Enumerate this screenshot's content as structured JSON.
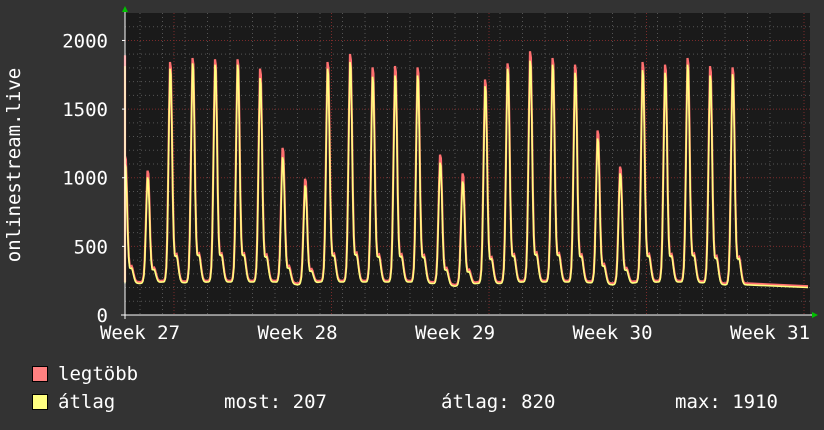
{
  "chart_data": {
    "type": "line",
    "ylabel": "onlinestream.live",
    "y_ticks": [
      0,
      500,
      1000,
      1500,
      2000
    ],
    "ylim": [
      0,
      2200
    ],
    "x_ticks": [
      "Week 27",
      "Week 28",
      "Week 29",
      "Week 30",
      "Week 31"
    ],
    "grid": true,
    "daily_peaks_max": [
      1930,
      1900,
      1180,
      1070,
      1880,
      1910,
      1900,
      1900,
      1830,
      1240,
      1010,
      1880,
      1940,
      1840,
      1850,
      1840,
      1190,
      1050,
      1750,
      1870,
      1960,
      1910,
      1860,
      1370,
      1100,
      1880,
      1860,
      1910,
      1850,
      1840
    ],
    "daily_peaks_avg": [
      1850,
      1830,
      1120,
      1020,
      1830,
      1870,
      1860,
      1860,
      1760,
      1170,
      960,
      1830,
      1880,
      1770,
      1780,
      1780,
      1130,
      990,
      1700,
      1830,
      1890,
      1860,
      1800,
      1310,
      1050,
      1820,
      1800,
      1860,
      1780,
      1790
    ],
    "daily_troughs": [
      240,
      240,
      250,
      240,
      250,
      245,
      250,
      250,
      250,
      250,
      230,
      250,
      250,
      250,
      250,
      250,
      240,
      220,
      240,
      240,
      250,
      250,
      250,
      245,
      230,
      245,
      250,
      250,
      245,
      230
    ],
    "series": [
      {
        "name": "legtöbb",
        "color": "#ff7070"
      },
      {
        "name": "átlag",
        "color": "#ffff80"
      }
    ]
  },
  "legend": {
    "max_label": "legtöbb",
    "avg_label": "átlag",
    "max_color": "#ff8080",
    "avg_color": "#ffff80"
  },
  "stats": {
    "current": "most: 207",
    "average": "átlag: 820",
    "maximum": "max: 1910"
  }
}
